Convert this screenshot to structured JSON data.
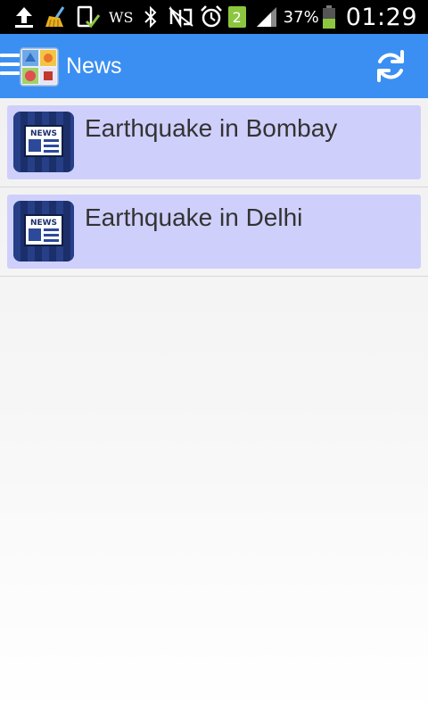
{
  "status_bar": {
    "icons": [
      "upload-icon",
      "broom-icon",
      "phone-check-icon",
      "bluetooth-icon",
      "nfc-off-icon",
      "alarm-icon",
      "signal-icon",
      "battery-icon"
    ],
    "ws_label": "WS",
    "sim_number": "2",
    "battery_percent": "37%",
    "time": "01:29",
    "battery_color": "#8cc63f"
  },
  "action_bar": {
    "title": "News",
    "background": "#3b8ff2",
    "menu_icon": "hamburger-icon",
    "logo_icon": "app-logo-icon",
    "refresh_icon": "refresh-icon"
  },
  "news_list": {
    "items": [
      {
        "title": "Earthquake in Bombay",
        "icon": "news-icon",
        "icon_text": "NEWS"
      },
      {
        "title": "Earthquake in Delhi",
        "icon": "news-icon",
        "icon_text": "NEWS"
      }
    ],
    "card_color": "#cfcffc"
  }
}
